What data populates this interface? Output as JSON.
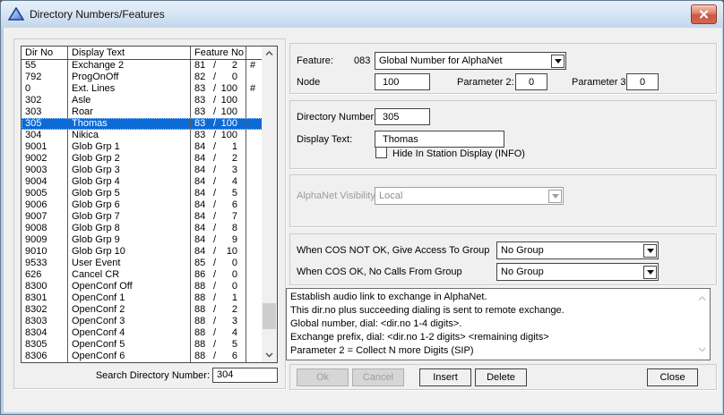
{
  "window": {
    "title": "Directory Numbers/Features"
  },
  "colors": {
    "selection": "#0b6ad5",
    "close_button": "#cc5844",
    "titlebar": "#d8e6f4"
  },
  "list": {
    "headers": [
      "Dir No",
      "Display Text",
      "Feature No"
    ],
    "rows": [
      {
        "dir": "55",
        "text": "Exchange 2",
        "fno": "81",
        "fparam": "2",
        "mark": "#",
        "selected": false
      },
      {
        "dir": "792",
        "text": "ProgOnOff",
        "fno": "82",
        "fparam": "0",
        "mark": "",
        "selected": false
      },
      {
        "dir": "0",
        "text": "Ext. Lines",
        "fno": "83",
        "fparam": "100",
        "mark": "#",
        "selected": false
      },
      {
        "dir": "302",
        "text": "Asle",
        "fno": "83",
        "fparam": "100",
        "mark": "",
        "selected": false
      },
      {
        "dir": "303",
        "text": "Roar",
        "fno": "83",
        "fparam": "100",
        "mark": "",
        "selected": false
      },
      {
        "dir": "305",
        "text": "Thomas",
        "fno": "83",
        "fparam": "100",
        "mark": "",
        "selected": true
      },
      {
        "dir": "304",
        "text": "Nikica",
        "fno": "83",
        "fparam": "100",
        "mark": "",
        "selected": false
      },
      {
        "dir": "9001",
        "text": "Glob Grp 1",
        "fno": "84",
        "fparam": "1",
        "mark": "",
        "selected": false
      },
      {
        "dir": "9002",
        "text": "Glob Grp 2",
        "fno": "84",
        "fparam": "2",
        "mark": "",
        "selected": false
      },
      {
        "dir": "9003",
        "text": "Glob Grp 3",
        "fno": "84",
        "fparam": "3",
        "mark": "",
        "selected": false
      },
      {
        "dir": "9004",
        "text": "Glob Grp 4",
        "fno": "84",
        "fparam": "4",
        "mark": "",
        "selected": false
      },
      {
        "dir": "9005",
        "text": "Glob Grp 5",
        "fno": "84",
        "fparam": "5",
        "mark": "",
        "selected": false
      },
      {
        "dir": "9006",
        "text": "Glob Grp 6",
        "fno": "84",
        "fparam": "6",
        "mark": "",
        "selected": false
      },
      {
        "dir": "9007",
        "text": "Glob Grp 7",
        "fno": "84",
        "fparam": "7",
        "mark": "",
        "selected": false
      },
      {
        "dir": "9008",
        "text": "Glob Grp 8",
        "fno": "84",
        "fparam": "8",
        "mark": "",
        "selected": false
      },
      {
        "dir": "9009",
        "text": "Glob Grp 9",
        "fno": "84",
        "fparam": "9",
        "mark": "",
        "selected": false
      },
      {
        "dir": "9010",
        "text": "Glob Grp 10",
        "fno": "84",
        "fparam": "10",
        "mark": "",
        "selected": false
      },
      {
        "dir": "9533",
        "text": "User Event",
        "fno": "85",
        "fparam": "0",
        "mark": "",
        "selected": false
      },
      {
        "dir": "626",
        "text": "Cancel CR",
        "fno": "86",
        "fparam": "0",
        "mark": "",
        "selected": false
      },
      {
        "dir": "8300",
        "text": "OpenConf Off",
        "fno": "88",
        "fparam": "0",
        "mark": "",
        "selected": false
      },
      {
        "dir": "8301",
        "text": "OpenConf 1",
        "fno": "88",
        "fparam": "1",
        "mark": "",
        "selected": false
      },
      {
        "dir": "8302",
        "text": "OpenConf 2",
        "fno": "88",
        "fparam": "2",
        "mark": "",
        "selected": false
      },
      {
        "dir": "8303",
        "text": "OpenConf 3",
        "fno": "88",
        "fparam": "3",
        "mark": "",
        "selected": false
      },
      {
        "dir": "8304",
        "text": "OpenConf 4",
        "fno": "88",
        "fparam": "4",
        "mark": "",
        "selected": false
      },
      {
        "dir": "8305",
        "text": "OpenConf 5",
        "fno": "88",
        "fparam": "5",
        "mark": "",
        "selected": false
      },
      {
        "dir": "8306",
        "text": "OpenConf 6",
        "fno": "88",
        "fparam": "6",
        "mark": "",
        "selected": false
      }
    ],
    "search_label": "Search Directory Number:",
    "search_value": "304"
  },
  "feature": {
    "label": "Feature:",
    "code": "083",
    "name": "Global Number for AlphaNet",
    "node_label": "Node",
    "node_value": "100",
    "param2_label": "Parameter 2:",
    "param2_value": "0",
    "param3_label": "Parameter 3",
    "param3_value": "0"
  },
  "directory": {
    "number_label": "Directory Number:",
    "number_value": "305",
    "display_label": "Display Text:",
    "display_value": "Thomas",
    "hide_label": "Hide In Station Display (INFO)",
    "hide_checked": false
  },
  "visibility": {
    "label": "AlphaNet Visibility:",
    "value": "Local"
  },
  "cos": {
    "not_ok_label": "When COS NOT OK, Give Access To Group",
    "not_ok_value": "No Group",
    "ok_label": "When COS OK, No Calls From Group",
    "ok_value": "No Group"
  },
  "info_lines": [
    "Establish audio link to exchange in AlphaNet.",
    "This dir.no plus succeeding dialing is sent to remote exchange.",
    "Global number, dial: <dir.no 1-4 digits>.",
    "Exchange prefix, dial: <dir.no 1-2 digits> <remaining digits>",
    "Parameter 2 = Collect N more Digits (SIP)"
  ],
  "buttons": {
    "ok": "Ok",
    "cancel": "Cancel",
    "insert": "Insert",
    "delete": "Delete",
    "close": "Close"
  }
}
